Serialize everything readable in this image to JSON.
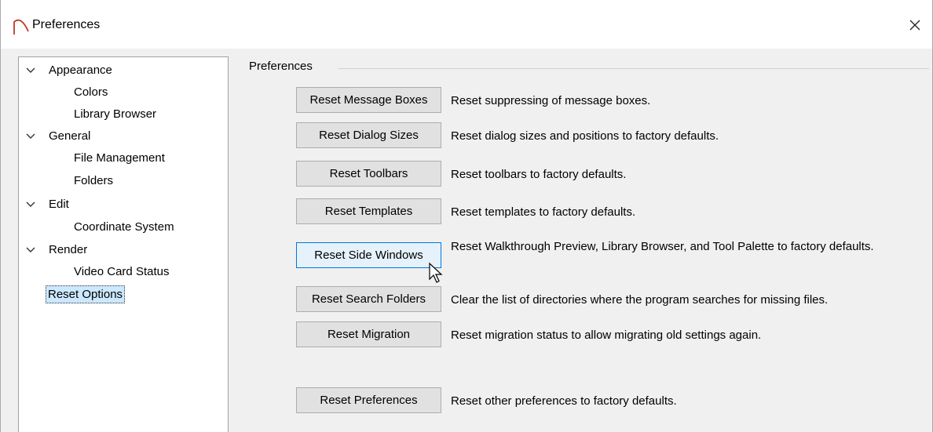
{
  "window": {
    "title": "Preferences"
  },
  "tree": {
    "items": [
      {
        "label": "Appearance",
        "level": 0,
        "expanded": true
      },
      {
        "label": "Colors",
        "level": 1
      },
      {
        "label": "Library Browser",
        "level": 1
      },
      {
        "label": "General",
        "level": 0,
        "expanded": true
      },
      {
        "label": "File Management",
        "level": 1
      },
      {
        "label": "Folders",
        "level": 1
      },
      {
        "label": "Edit",
        "level": 0,
        "expanded": true
      },
      {
        "label": "Coordinate System",
        "level": 1
      },
      {
        "label": "Render",
        "level": 0,
        "expanded": true
      },
      {
        "label": "Video Card Status",
        "level": 1
      },
      {
        "label": "Reset Options",
        "level": 0,
        "selected": true
      }
    ]
  },
  "group": {
    "label": "Preferences"
  },
  "options": [
    {
      "button": "Reset Message Boxes",
      "description": "Reset suppressing of message boxes."
    },
    {
      "button": "Reset Dialog Sizes",
      "description": "Reset dialog sizes and positions to factory defaults."
    },
    {
      "button": "Reset Toolbars",
      "description": "Reset toolbars to factory defaults."
    },
    {
      "button": "Reset Templates",
      "description": "Reset templates to factory defaults."
    },
    {
      "button": "Reset Side Windows",
      "description": "Reset Walkthrough Preview, Library Browser, and Tool Palette to factory defaults.",
      "focused": true
    },
    {
      "button": "Reset Search Folders",
      "description": "Clear the list of directories where the program searches for missing files."
    },
    {
      "button": "Reset Migration",
      "description": "Reset migration status to allow migrating old settings again."
    },
    {
      "button": "Reset Preferences",
      "description": "Reset other preferences to factory defaults."
    }
  ],
  "colors": {
    "accent": "#0078d7",
    "selection": "#cce8ff",
    "icon": "#c0392b"
  }
}
